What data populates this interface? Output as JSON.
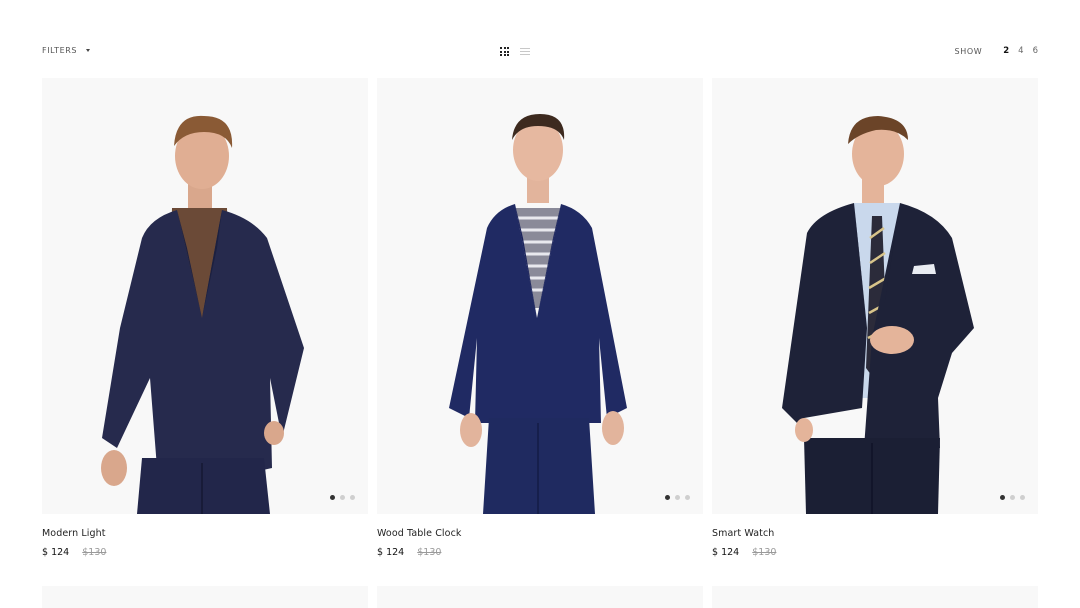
{
  "toolbar": {
    "filters_label": "FILTERS",
    "show_label": "SHOW",
    "show_options": [
      "2",
      "4",
      "6"
    ],
    "show_selected": "2",
    "view_mode": "grid"
  },
  "products": [
    {
      "name": "Modern Light",
      "price": "$ 124",
      "old_price": "$130",
      "slides": 3,
      "active_slide": 1
    },
    {
      "name": "Wood Table Clock",
      "price": "$ 124",
      "old_price": "$130",
      "slides": 3,
      "active_slide": 1
    },
    {
      "name": "Smart Watch",
      "price": "$ 124",
      "old_price": "$130",
      "slides": 3,
      "active_slide": 1
    }
  ],
  "colors": {
    "image_background": "#f8f8f8",
    "suit_navy": "#24284a",
    "text_dark": "#222222",
    "old_price": "#9a9a9a"
  }
}
